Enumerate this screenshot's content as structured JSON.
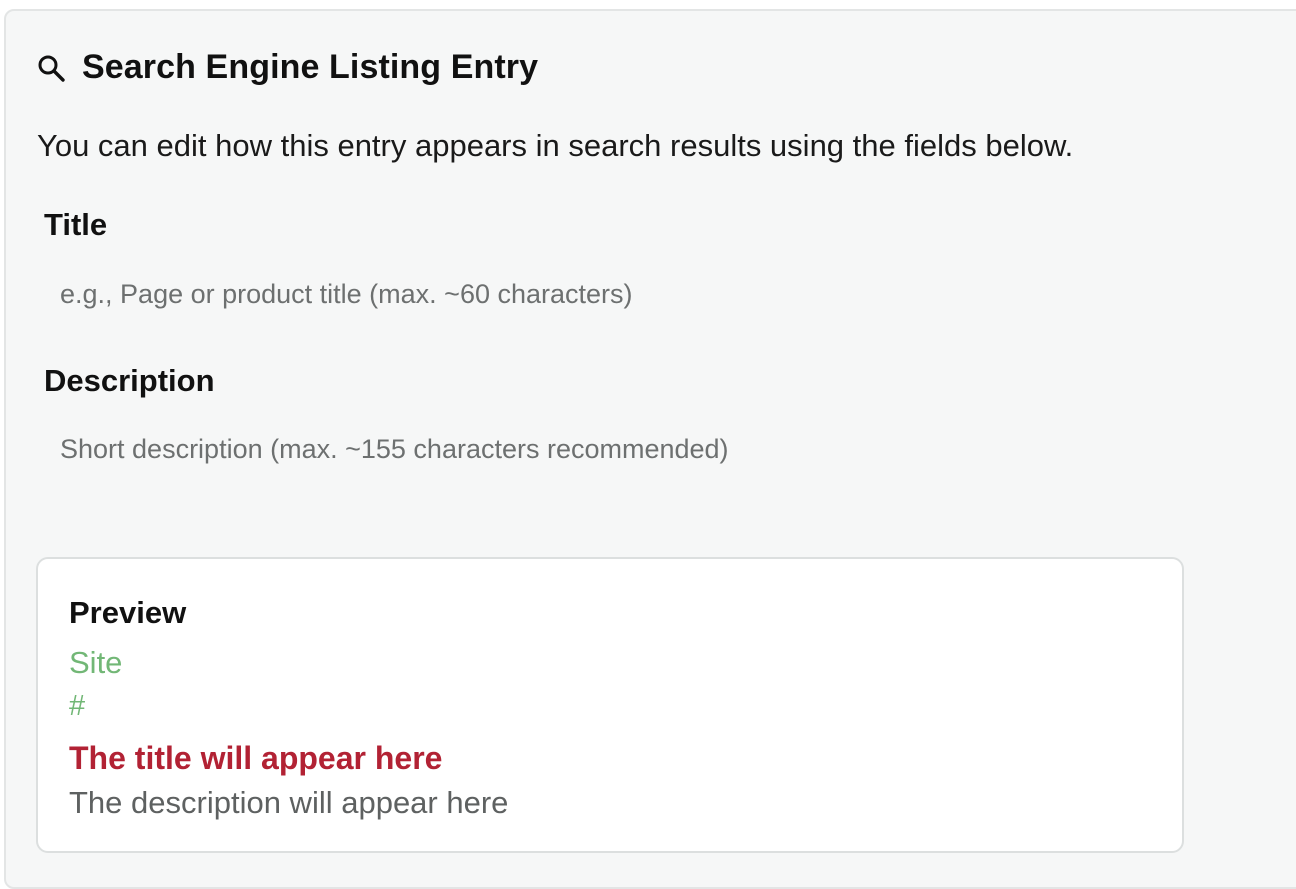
{
  "section": {
    "icon": "search-icon",
    "title": "Search Engine Listing Entry",
    "intro": "You can edit how this entry appears in search results using the fields below."
  },
  "fields": {
    "title": {
      "label": "Title",
      "value": "",
      "placeholder": "e.g., Page or product title (max. ~60 characters)"
    },
    "description": {
      "label": "Description",
      "value": "",
      "placeholder": "Short description (max. ~155 characters recommended)"
    }
  },
  "preview": {
    "label": "Preview",
    "site": "Site",
    "url": "#",
    "title": "The title will appear here",
    "description": "The description will appear here"
  },
  "colors": {
    "panel_background": "#f6f7f7",
    "preview_site_green": "#72b776",
    "preview_title_red": "#b22234",
    "preview_description_gray": "#5e6161"
  }
}
